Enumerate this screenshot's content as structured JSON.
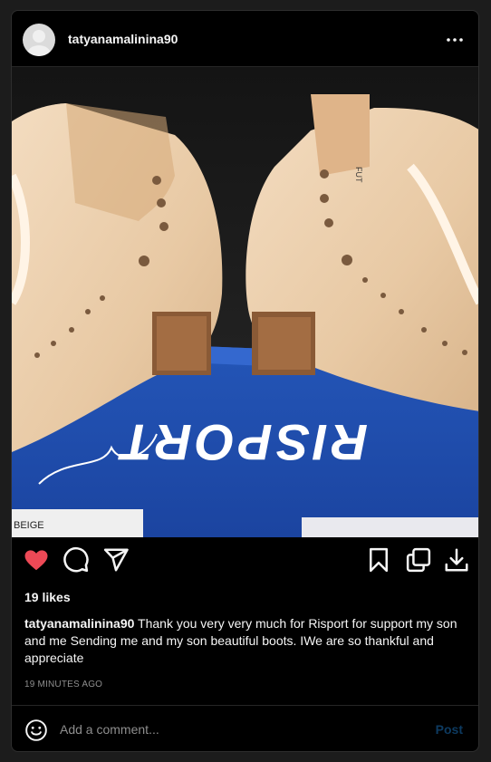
{
  "post": {
    "username": "tatyanamalinina90",
    "likes": "19 likes",
    "caption_user": "tatyanamalinina90",
    "caption_text": " Thank you very very much for Risport for support my son and me Sending me and my son beautiful boots. IWe are so thankful and appreciate",
    "timestamp": "19 MINUTES AGO"
  },
  "image": {
    "box_brand": "RISPORT",
    "label_color": "BEIGE",
    "tag_text": "FUT"
  },
  "comment": {
    "placeholder": "Add a comment...",
    "post_label": "Post"
  },
  "colors": {
    "like_red": "#ed4956",
    "post_disabled": "#0d3a60"
  },
  "icons": [
    "more-options-icon",
    "heart-icon",
    "comment-icon",
    "share-icon",
    "bookmark-icon",
    "copy-icon",
    "download-icon",
    "emoji-icon"
  ]
}
